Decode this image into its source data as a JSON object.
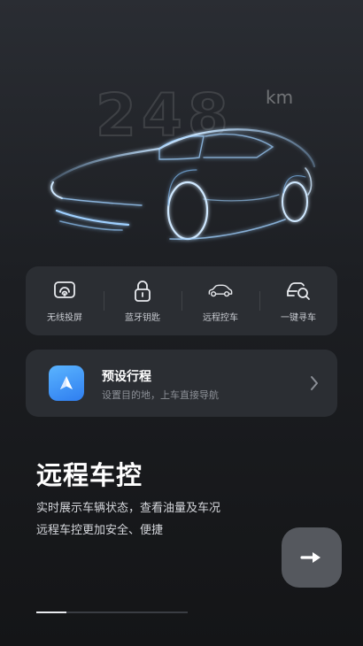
{
  "hero": {
    "range_value": "248",
    "range_unit": "km"
  },
  "quick_actions": [
    {
      "label": "无线投屏",
      "icon": "wireless-cast-icon"
    },
    {
      "label": "蓝牙钥匙",
      "icon": "bluetooth-key-icon"
    },
    {
      "label": "远程控车",
      "icon": "remote-car-icon"
    },
    {
      "label": "一键寻车",
      "icon": "find-car-icon"
    }
  ],
  "trip": {
    "title": "预设行程",
    "subtitle": "设置目的地，上车直接导航",
    "icon": "navigation-arrow-icon"
  },
  "promo": {
    "title": "远程车控",
    "line1": "实时展示车辆状态，查看油量及车况",
    "line2": "远程车控更加安全、便捷"
  },
  "onboarding": {
    "progress": 0.2,
    "next_icon": "arrow-right-icon"
  },
  "colors": {
    "accent_blue": "#3a8cf4",
    "car_glow": "#9fd0ff"
  }
}
